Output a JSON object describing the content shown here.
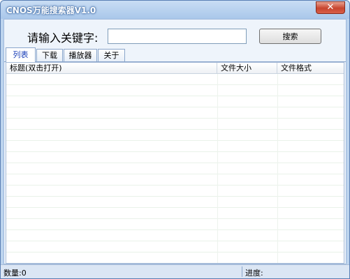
{
  "window": {
    "title": "CNOS万能搜索器V1.0",
    "close_symbol": "✕"
  },
  "search": {
    "label": "请输入关键字:",
    "value": "",
    "placeholder": "",
    "button_label": "搜索"
  },
  "tabs": [
    {
      "label": "列表",
      "active": true
    },
    {
      "label": "下载",
      "active": false
    },
    {
      "label": "播放器",
      "active": false
    },
    {
      "label": "关于",
      "active": false
    }
  ],
  "list": {
    "columns": [
      "标题(双击打开)",
      "文件大小",
      "文件格式"
    ],
    "rows": []
  },
  "status": {
    "count_label": "数量:0",
    "progress_label": "进度:"
  },
  "icons": {
    "close": "close-icon"
  },
  "colors": {
    "frame": "#bcd4ee",
    "active_tab_text": "#1a3fb8",
    "close_button": "#c7452f"
  }
}
